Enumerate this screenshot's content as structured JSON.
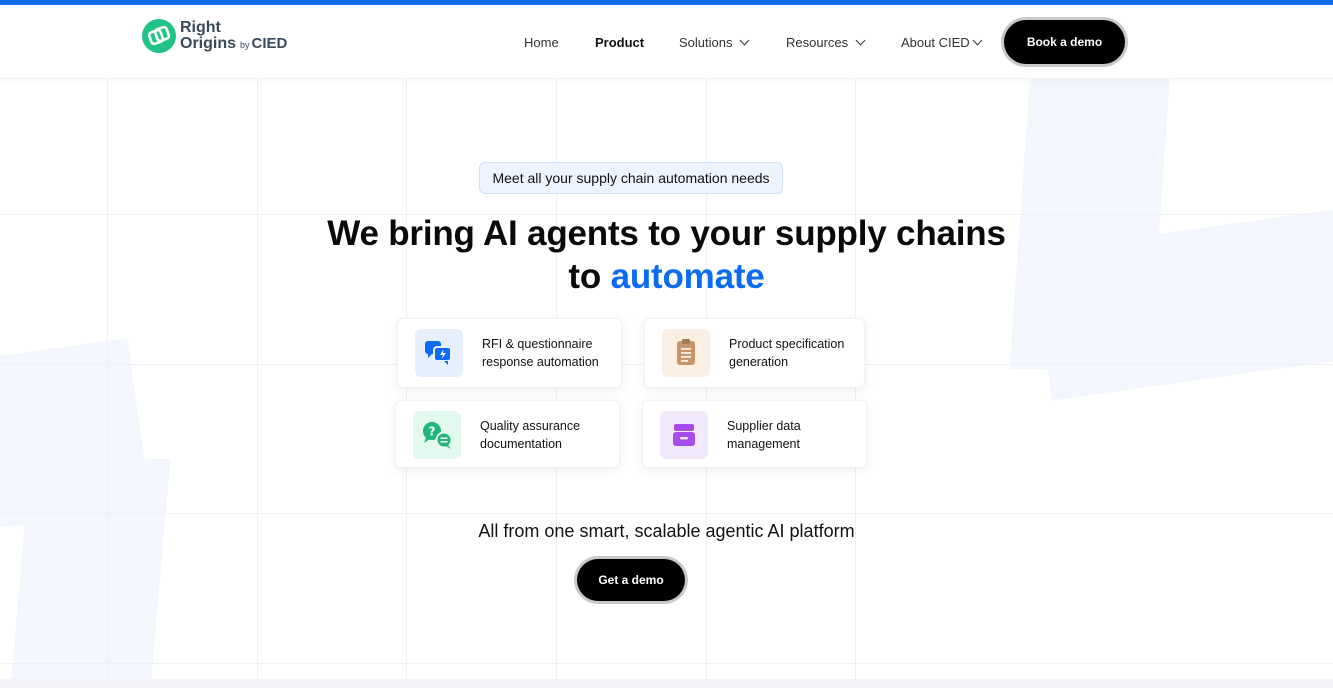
{
  "brand": {
    "name_line1": "Right",
    "name_line2": "Origins",
    "by": "by",
    "parent": "CIED"
  },
  "nav": {
    "items": [
      {
        "label": "Home"
      },
      {
        "label": "Product"
      },
      {
        "label": "Solutions"
      },
      {
        "label": "Resources"
      },
      {
        "label": "About CIED"
      }
    ],
    "cta": "Book a demo"
  },
  "hero": {
    "pill": "Meet all your supply chain automation needs",
    "headline_line1": "We bring AI agents to your supply chains",
    "headline_line2_prefix": "to ",
    "headline_accent": "automate",
    "tagline": "All from one smart, scalable agentic AI platform",
    "cta": "Get a demo"
  },
  "features": [
    {
      "line1": "RFI & questionnaire",
      "line2": "response automation",
      "icon": "chat-bolt-icon"
    },
    {
      "line1": "Product specification",
      "line2": "generation",
      "icon": "clipboard-icon"
    },
    {
      "line1": "Quality assurance",
      "line2": "documentation",
      "icon": "question-chat-icon"
    },
    {
      "line1": "Supplier data",
      "line2": "management",
      "icon": "archive-box-icon"
    }
  ],
  "colors": {
    "accent": "#0b6cf2",
    "brand_green": "#22c389"
  }
}
